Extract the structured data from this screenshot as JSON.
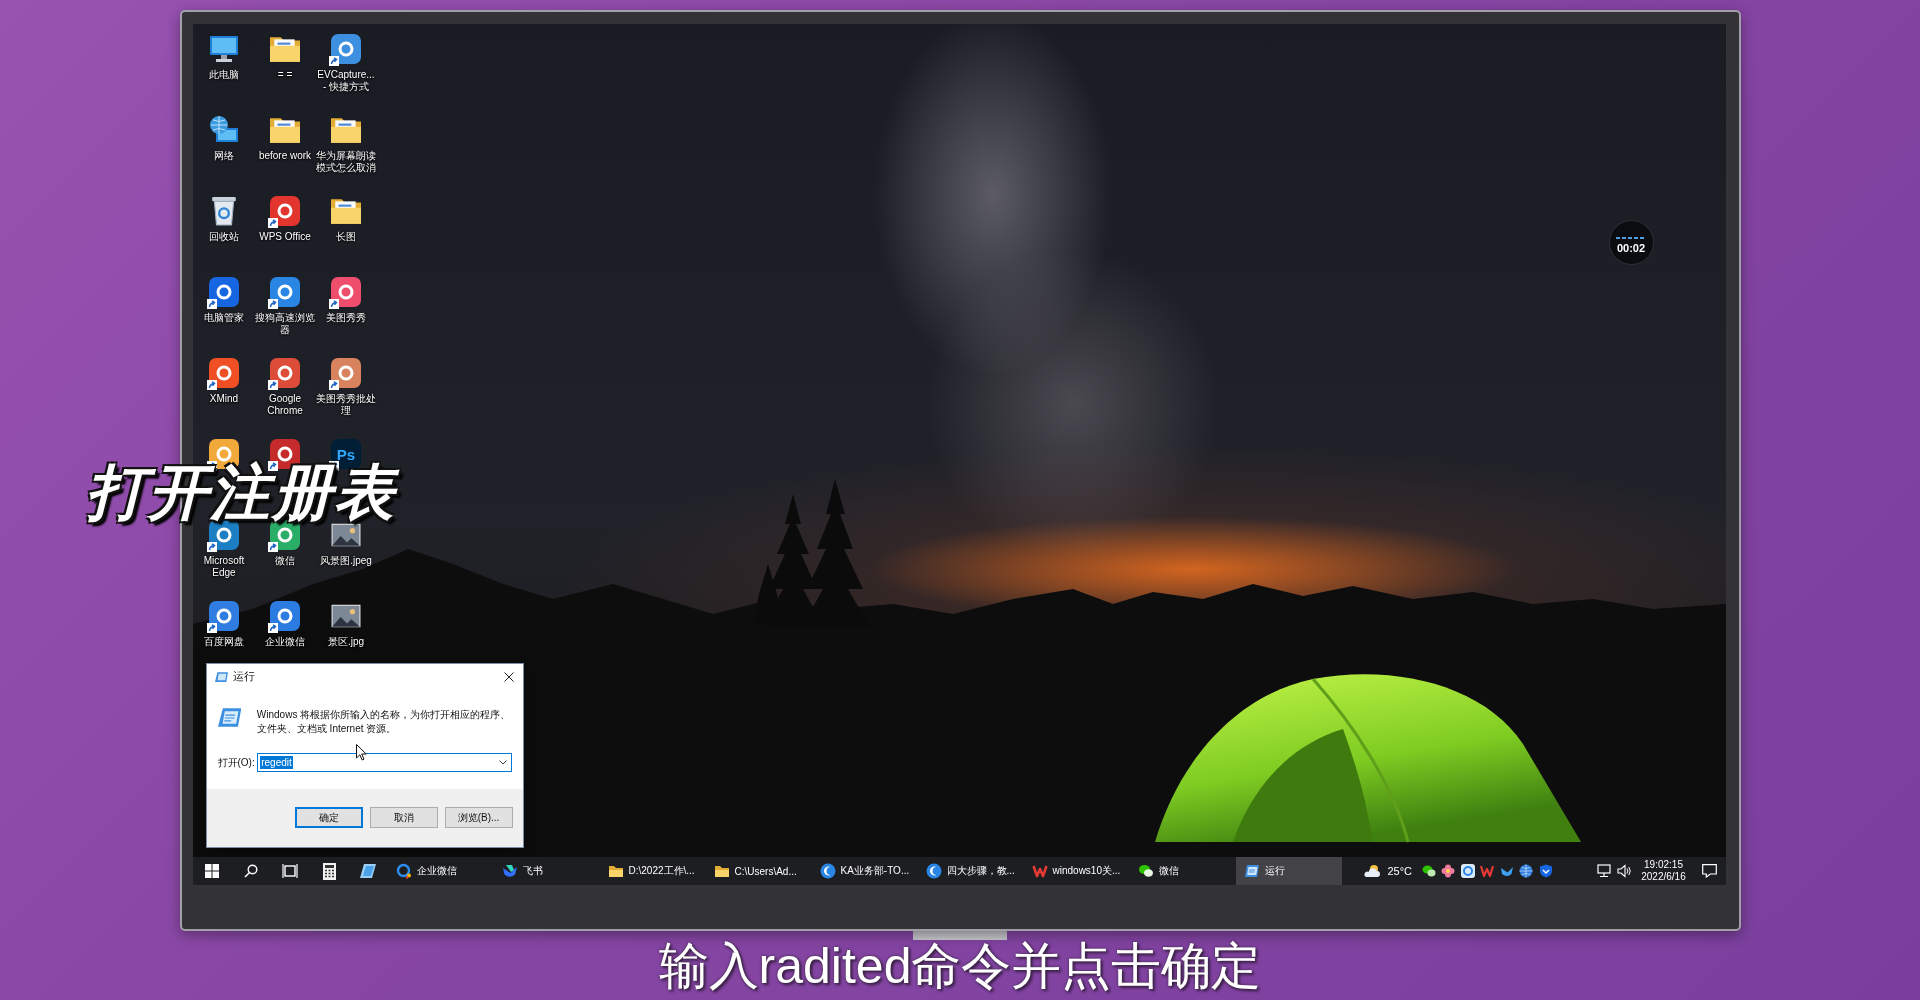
{
  "overlay_title": "打开注册表",
  "subtitle": "输入radited命令并点击确定",
  "recording_timer": "00:02",
  "desktop_icons": [
    {
      "label": "此电脑",
      "kind": "computer",
      "shortcut": false
    },
    {
      "label": "= =",
      "kind": "folder",
      "shortcut": false
    },
    {
      "label": "EVCapture... - 快捷方式",
      "kind": "app",
      "color": "#3d8fe0",
      "shortcut": true
    },
    {
      "label": "网络",
      "kind": "network",
      "shortcut": false
    },
    {
      "label": "before work",
      "kind": "folder",
      "shortcut": false
    },
    {
      "label": "华为屏幕朗读模式怎么取消",
      "kind": "folder",
      "shortcut": false
    },
    {
      "label": "回收站",
      "kind": "recycle",
      "shortcut": false
    },
    {
      "label": "WPS Office",
      "kind": "app",
      "color": "#e2352d",
      "shortcut": true
    },
    {
      "label": "长图",
      "kind": "folder",
      "shortcut": false
    },
    {
      "label": "电脑管家",
      "kind": "app",
      "color": "#1566e0",
      "shortcut": true
    },
    {
      "label": "搜狗高速浏览器",
      "kind": "app",
      "color": "#2a86e4",
      "shortcut": true
    },
    {
      "label": "美图秀秀",
      "kind": "app",
      "color": "#ee4d6c",
      "shortcut": true
    },
    {
      "label": "XMind",
      "kind": "app",
      "color": "#f04e23",
      "shortcut": true
    },
    {
      "label": "Google Chrome",
      "kind": "app",
      "color": "#dd4b39",
      "shortcut": true
    },
    {
      "label": "美图秀秀批处理",
      "kind": "app",
      "color": "#d9825e",
      "shortcut": true
    },
    {
      "kind": "app",
      "color": "#f2a93b",
      "shortcut": true
    },
    {
      "kind": "app",
      "color": "#c62b2b",
      "shortcut": true
    },
    {
      "kind": "app",
      "color": "#001e36",
      "glyph": "Ps",
      "shortcut": true
    },
    {
      "label": "Microsoft Edge",
      "kind": "app",
      "color": "#1c7fc4",
      "shortcut": true
    },
    {
      "label": "微信",
      "kind": "app",
      "color": "#2aae67",
      "shortcut": true
    },
    {
      "label": "风景图.jpeg",
      "kind": "image",
      "shortcut": false
    },
    {
      "label": "百度网盘",
      "kind": "app",
      "color": "#2f7de1",
      "shortcut": true
    },
    {
      "label": "企业微信",
      "kind": "app",
      "color": "#2b7be0",
      "shortcut": true
    },
    {
      "label": "景区.jpg",
      "kind": "image",
      "shortcut": false
    }
  ],
  "run_dialog": {
    "title": "运行",
    "message": "Windows 将根据你所输入的名称，为你打开相应的程序、文件夹、文档或 Internet 资源。",
    "open_label": "打开(O):",
    "value": "regedit",
    "text_selected": true,
    "buttons": [
      {
        "label": "确定",
        "default": true
      },
      {
        "label": "取消",
        "default": false
      },
      {
        "label": "浏览(B)...",
        "default": false
      }
    ]
  },
  "taskbar": {
    "windows": [
      {
        "label": "企业微信",
        "kind": "chat",
        "selected": false
      },
      {
        "label": "飞书",
        "kind": "bird",
        "selected": false
      },
      {
        "label": "D:\\2022工作\\...",
        "kind": "folder",
        "selected": false
      },
      {
        "label": "C:\\Users\\Ad...",
        "kind": "folder",
        "selected": false
      },
      {
        "label": "KA业务部-TO...",
        "kind": "browser",
        "selected": false
      },
      {
        "label": "四大步骤，教...",
        "kind": "browser",
        "selected": false
      },
      {
        "label": "windows10关...",
        "kind": "wps",
        "selected": false
      },
      {
        "label": "微信",
        "kind": "wechat",
        "selected": false
      },
      {
        "label": "运行",
        "kind": "run",
        "selected": true
      }
    ],
    "temperature": "25°C",
    "time": "19:02:15",
    "date": "2022/6/16"
  }
}
